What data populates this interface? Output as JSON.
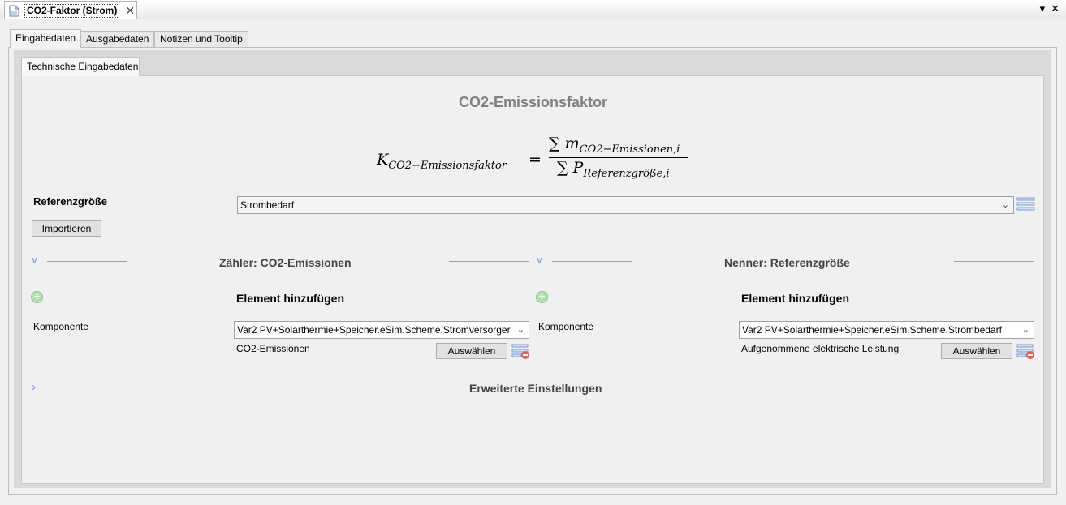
{
  "editor_tab": {
    "title": "CO2-Faktor (Strom)",
    "close": "✕"
  },
  "view_controls": {
    "menu": "▾",
    "close": "✕"
  },
  "main_tabs": [
    {
      "label": "Eingabedaten"
    },
    {
      "label": "Ausgabedaten"
    },
    {
      "label": "Notizen und Tooltip"
    }
  ],
  "sub_tab": {
    "label": "Technische Eingabedaten"
  },
  "section_title": "CO2-Emissionsfaktor",
  "formula": {
    "lhs_symbol": "K",
    "lhs_subscript": "CO2−Emissionsfaktor",
    "equals": "=",
    "sum": "∑",
    "numerator_symbol": "m",
    "numerator_subscript": "CO2−Emissionen,i",
    "denominator_symbol": "P",
    "denominator_subscript": "Referenzgröße,i"
  },
  "referenz": {
    "label": "Referenzgröße",
    "select_value": "Strombedarf",
    "import_button": "Importieren"
  },
  "counter": {
    "heading": "Zähler: CO2-Emissionen",
    "add_heading": "Element hinzufügen",
    "component_label": "Komponente",
    "component_value": "Var2 PV+Solarthermie+Speicher.eSim.Scheme.Stromversorger",
    "variable_label": "CO2-Emissionen",
    "select_button": "Auswählen"
  },
  "denominator": {
    "heading": "Nenner: Referenzgröße",
    "add_heading": "Element hinzufügen",
    "component_label": "Komponente",
    "component_value": "Var2 PV+Solarthermie+Speicher.eSim.Scheme.Strombedarf",
    "variable_label": "Aufgenommene elektrische Leistung",
    "select_button": "Auswählen"
  },
  "advanced": {
    "heading": "Erweiterte Einstellungen"
  },
  "icons": {
    "document": "document-icon",
    "chevron_down": "∨",
    "chevron_right": "›",
    "plus": "+"
  },
  "colors": {
    "title_gray": "#808080",
    "icon_blue": "#7d9bd1",
    "add_green": "#b5dfb3",
    "remove_red": "#e06060"
  }
}
